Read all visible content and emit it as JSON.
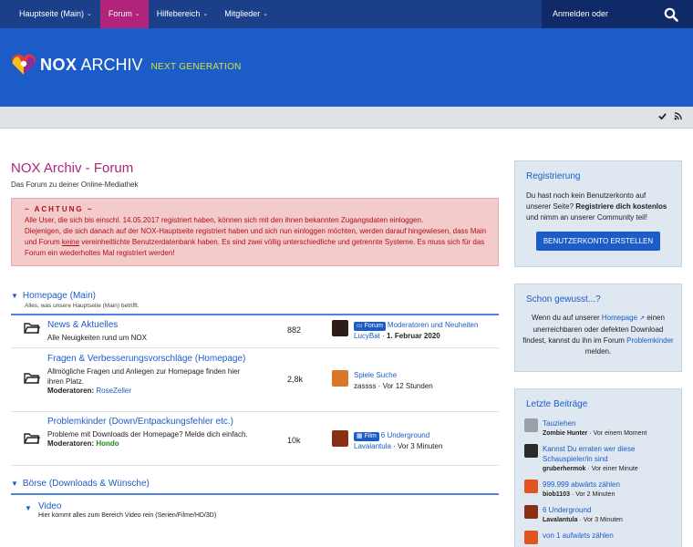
{
  "nav": {
    "items": [
      {
        "label": "Hauptseite (Main)"
      },
      {
        "label": "Forum"
      },
      {
        "label": "Hilfebereich"
      },
      {
        "label": "Mitglieder"
      }
    ],
    "login": "Anmelden oder registrieren"
  },
  "header": {
    "logo_nox": "NOX",
    "logo_archiv": "ARCHIV",
    "logo_next": "NEXT GENERATION"
  },
  "page": {
    "title": "NOX Archiv - Forum",
    "description": "Das Forum zu deiner Online-Mediathek"
  },
  "notice": {
    "title": "~ ACHTUNG ~",
    "line1": "Alle User, die sich bis einschl. 14.05.2017 registriert haben, können sich mit den ihnen bekannten Zugangsdaten einloggen.",
    "line2a": "Diejenigen, die sich danach auf der NOX-Hauptseite registriert haben und sich nun einloggen möchten, werden darauf hingewiesen, dass Main und Forum ",
    "line2u": "keine",
    "line2b": " vereinheitlichte Benutzerdatenbank haben. Es sind zwei völlig unterschiedliche und getrennte Systeme. Es muss sich für das Forum ein wiederholtes Mal registriert werden!"
  },
  "categories": [
    {
      "title": "Homepage (Main)",
      "description": "Alles, was unsere Hauptseite (Main) betrifft.",
      "forums": [
        {
          "title": "News & Aktuelles",
          "description": "Alle Neuigkeiten rund um NOX",
          "count": "882",
          "last_badge": "Forum",
          "last_title": "Moderatoren und Neuheiten",
          "last_user": "LucyBat",
          "last_time": "1. Februar 2020"
        },
        {
          "title": "Fragen & Verbesserungsvorschläge (Homepage)",
          "description": "Allmögliche Fragen und Anliegen zur Homepage finden hier ihren Platz.",
          "mods_label": "Moderatoren:",
          "mods": "RoseZeller",
          "count": "2,8k",
          "last_title": "Spiele Suche",
          "last_user": "zassss",
          "last_time": "Vor 12 Stunden"
        },
        {
          "title": "Problemkinder (Down/Entpackungsfehler etc.)",
          "description": "Probleme mit Downloads der Homepage? Melde dich einfach.",
          "mods_label": "Moderatoren:",
          "mods": "Hondo",
          "count": "10k",
          "last_badge": "Film",
          "last_title": "6 Underground",
          "last_user": "Lavalantula",
          "last_time": "Vor 3 Minuten"
        }
      ]
    },
    {
      "title": "Börse (Downloads & Wünsche)",
      "forums": [
        {
          "title": "Video",
          "description": "Hier kommt alles zum Bereich Video rein (Serien/Filme/HD/3D)"
        }
      ]
    }
  ],
  "sidebar": {
    "register": {
      "title": "Registrierung",
      "text1": "Du hast noch kein Benutzerkonto auf unserer Seite? ",
      "text_bold": "Registriere dich kostenlos",
      "text2": " und nimm an unserer Community teil!",
      "button": "BENUTZERKONTO ERSTELLEN"
    },
    "didyouknow": {
      "title": "Schon gewusst...?",
      "t1": "Wenn du auf unserer ",
      "link1": "Homepage",
      "t2": " einen unerreichbaren oder defekten Download findest, kannst du ihn im Forum ",
      "link2": "Problemkinder",
      "t3": " melden."
    },
    "recent": {
      "title": "Letzte Beiträge",
      "items": [
        {
          "title": "Tauziehen",
          "user": "Zombie Hunter",
          "time": "Vor einem Moment"
        },
        {
          "title": "Kannst Du erraten wer diese Schauspieler/in sind",
          "user": "gruberhermok",
          "time": "Vor einer Minute"
        },
        {
          "title": "999.999 abwärts zählen",
          "user": "biob1103",
          "time": "Vor 2 Minuten"
        },
        {
          "title": "6 Underground",
          "user": "Lavalantula",
          "time": "Vor 3 Minuten"
        },
        {
          "title": "von 1 aufwärts zählen"
        }
      ]
    }
  },
  "colors": {
    "nav_bg": "#1c3f8a",
    "header_bg": "#1c5cc7",
    "active_nav": "#b2237b",
    "title_pink": "#b2237b",
    "link_blue": "#1c5cc7",
    "notice_bg": "#f4cbcb"
  }
}
